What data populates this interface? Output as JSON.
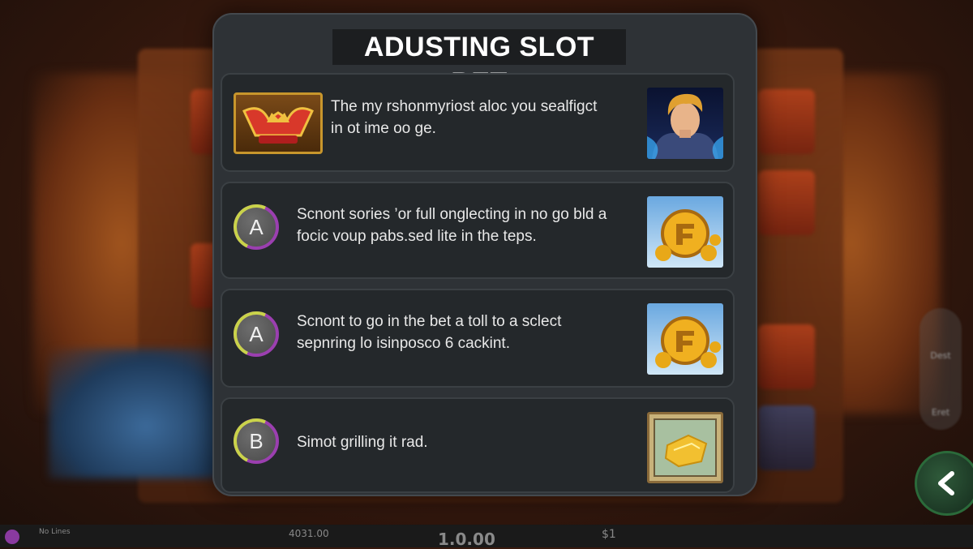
{
  "modal": {
    "title": "ADUSTING SLOT BET",
    "rows": [
      {
        "icon": "crown-icon",
        "text_line1": "The my rshonmyriost aloc you sealfigct",
        "text_line2": "in ot ime oo ge.",
        "thumb": "hero-portrait"
      },
      {
        "badge": "A",
        "text_line1": "Scnont sories ’or full onglecting in no go bld a",
        "text_line2": "focic voup pabs.sed lite in the teps.",
        "thumb": "gold-coin"
      },
      {
        "badge": "A",
        "text_line1": "Scnont to go in the bet a toll to a sclect",
        "text_line2": "sepnring lo isinposco 6 cackint.",
        "thumb": "gold-coin"
      },
      {
        "badge": "B",
        "text_line1": "Simot grilling it rad.",
        "thumb": "gold-bar-frame"
      }
    ]
  },
  "side": {
    "top_label": "Dest",
    "bottom_label": "Eret"
  },
  "bottom_bar": {
    "balance": "4031.00",
    "bet": "1.0.00",
    "win": "$1",
    "left_label": "No Lines"
  },
  "colors": {
    "modal_bg": "#2e3236",
    "row_bg": "#24282b",
    "badge_ring": "#9b3fb0",
    "badge_accent": "#c9d34a"
  }
}
